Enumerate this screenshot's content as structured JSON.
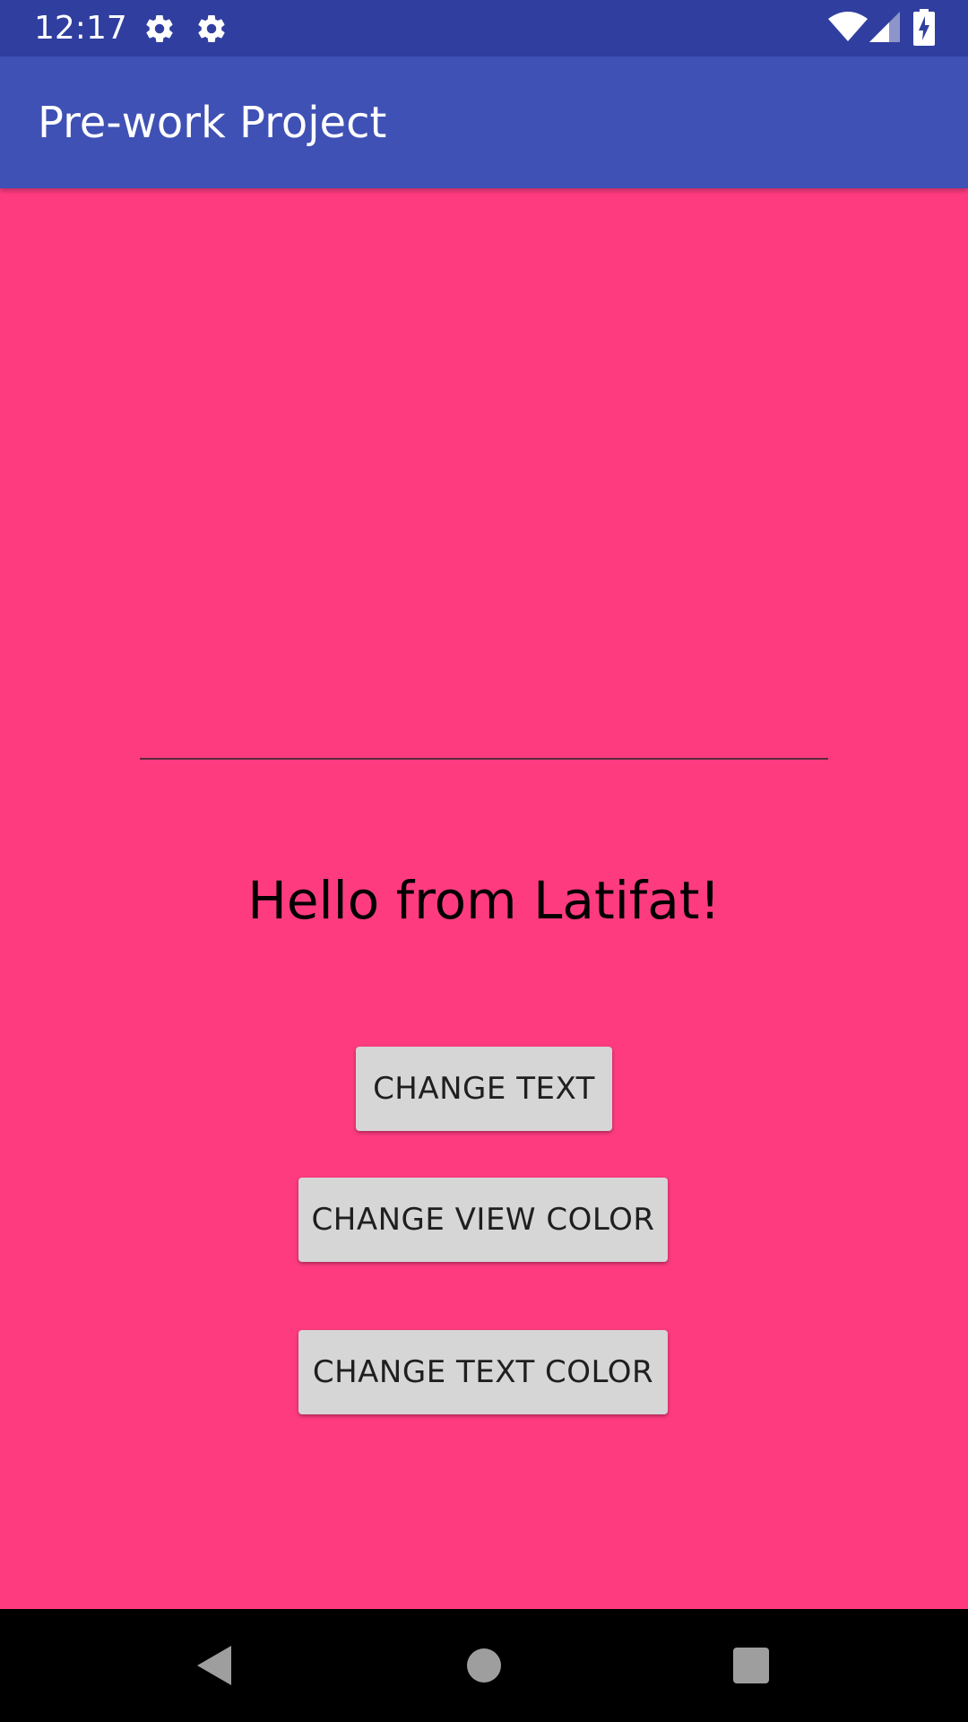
{
  "status_bar": {
    "time": "12:17",
    "icons": [
      "settings-gear-icon",
      "settings-gear-icon",
      "wifi-icon",
      "cell-signal-icon",
      "battery-charging-icon"
    ],
    "color": "#303f9f"
  },
  "app_bar": {
    "title": "Pre-work Project",
    "color": "#3f51b5"
  },
  "main": {
    "background_color": "#ff3b80",
    "text_input": {
      "value": "",
      "placeholder": ""
    },
    "greeting": "Hello from Latifat!",
    "buttons": {
      "change_text": "CHANGE TEXT",
      "change_view_color": "CHANGE VIEW COLOR",
      "change_text_color": "CHANGE TEXT COLOR"
    }
  },
  "nav_bar": {
    "items": [
      "back-icon",
      "home-icon",
      "recents-icon"
    ]
  }
}
